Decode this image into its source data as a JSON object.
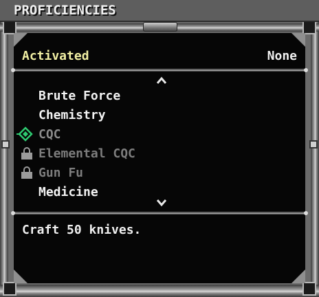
{
  "window": {
    "title": "PROFICIENCIES"
  },
  "header": {
    "activated_label": "Activated",
    "activated_value": "None"
  },
  "list": {
    "items": [
      {
        "label": "Brute Force",
        "state": "available"
      },
      {
        "label": "Chemistry",
        "state": "available"
      },
      {
        "label": "CQC",
        "state": "selected"
      },
      {
        "label": "Elemental CQC",
        "state": "locked"
      },
      {
        "label": "Gun Fu",
        "state": "locked"
      },
      {
        "label": "Medicine",
        "state": "available"
      }
    ],
    "scroll_up_icon": "chevron-up-icon",
    "scroll_down_icon": "chevron-down-icon",
    "selected_icon": "diamond-selector-icon",
    "locked_icon": "lock-icon"
  },
  "description": {
    "text": "Craft 50 knives."
  },
  "colors": {
    "frame": "#6b6b6b",
    "panel": "#060606",
    "activated_label": "#f2f0a4",
    "text": "#f4f4f4",
    "disabled_text": "#7d7d7d",
    "selector": "#2ecc71"
  }
}
